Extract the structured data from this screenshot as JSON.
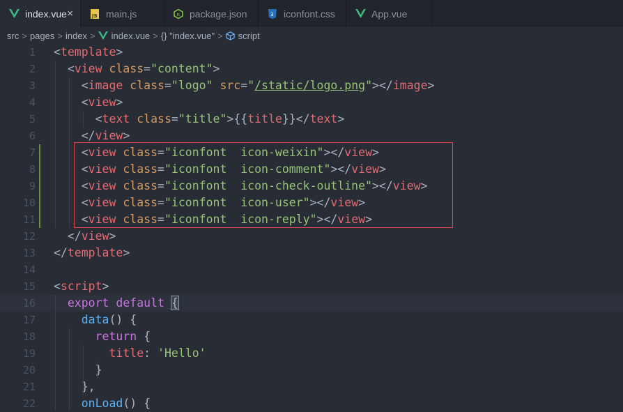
{
  "tabs": [
    {
      "label": "index.vue",
      "icon": "vue-icon",
      "active": true
    },
    {
      "label": "main.js",
      "icon": "js-icon"
    },
    {
      "label": "package.json",
      "icon": "npm-icon"
    },
    {
      "label": "iconfont.css",
      "icon": "css-icon"
    },
    {
      "label": "App.vue",
      "icon": "vue-icon"
    }
  ],
  "tab_close_glyph": "×",
  "breadcrumb": {
    "src": "src",
    "pages": "pages",
    "index": "index",
    "file": "index.vue",
    "obj": "{} \"index.vue\"",
    "script": "script",
    "sep": ">"
  },
  "colors": {
    "tag": "#e06c75",
    "attr": "#d19a66",
    "string": "#98c379",
    "keyword": "#c678dd",
    "function": "#61afef",
    "highlight_box": "#e0464a"
  },
  "code_lines": [
    [
      {
        "t": "<",
        "c": "p"
      },
      {
        "t": "template",
        "c": "t"
      },
      {
        "t": ">",
        "c": "p"
      }
    ],
    [
      {
        "t": "  <",
        "c": "p"
      },
      {
        "t": "view",
        "c": "t"
      },
      {
        "t": " ",
        "c": "p"
      },
      {
        "t": "class",
        "c": "a"
      },
      {
        "t": "=",
        "c": "p"
      },
      {
        "t": "\"content\"",
        "c": "s"
      },
      {
        "t": ">",
        "c": "p"
      }
    ],
    [
      {
        "t": "    <",
        "c": "p"
      },
      {
        "t": "image",
        "c": "t"
      },
      {
        "t": " ",
        "c": "p"
      },
      {
        "t": "class",
        "c": "a"
      },
      {
        "t": "=",
        "c": "p"
      },
      {
        "t": "\"logo\"",
        "c": "s"
      },
      {
        "t": " ",
        "c": "p"
      },
      {
        "t": "src",
        "c": "a"
      },
      {
        "t": "=",
        "c": "p"
      },
      {
        "t": "\"",
        "c": "s"
      },
      {
        "t": "/static/logo.png",
        "c": "s u"
      },
      {
        "t": "\"",
        "c": "s"
      },
      {
        "t": "></",
        "c": "p"
      },
      {
        "t": "image",
        "c": "t"
      },
      {
        "t": ">",
        "c": "p"
      }
    ],
    [
      {
        "t": "    <",
        "c": "p"
      },
      {
        "t": "view",
        "c": "t"
      },
      {
        "t": ">",
        "c": "p"
      }
    ],
    [
      {
        "t": "      <",
        "c": "p"
      },
      {
        "t": "text",
        "c": "t"
      },
      {
        "t": " ",
        "c": "p"
      },
      {
        "t": "class",
        "c": "a"
      },
      {
        "t": "=",
        "c": "p"
      },
      {
        "t": "\"title\"",
        "c": "s"
      },
      {
        "t": ">{{",
        "c": "p"
      },
      {
        "t": "title",
        "c": "t"
      },
      {
        "t": "}}</",
        "c": "p"
      },
      {
        "t": "text",
        "c": "t"
      },
      {
        "t": ">",
        "c": "p"
      }
    ],
    [
      {
        "t": "    </",
        "c": "p"
      },
      {
        "t": "view",
        "c": "t"
      },
      {
        "t": ">",
        "c": "p"
      }
    ],
    [
      {
        "t": "    <",
        "c": "p"
      },
      {
        "t": "view",
        "c": "t"
      },
      {
        "t": " ",
        "c": "p"
      },
      {
        "t": "class",
        "c": "a"
      },
      {
        "t": "=",
        "c": "p"
      },
      {
        "t": "\"iconfont  icon-weixin\"",
        "c": "s"
      },
      {
        "t": "></",
        "c": "p"
      },
      {
        "t": "view",
        "c": "t"
      },
      {
        "t": ">",
        "c": "p"
      }
    ],
    [
      {
        "t": "    <",
        "c": "p"
      },
      {
        "t": "view",
        "c": "t"
      },
      {
        "t": " ",
        "c": "p"
      },
      {
        "t": "class",
        "c": "a"
      },
      {
        "t": "=",
        "c": "p"
      },
      {
        "t": "\"iconfont  icon-comment\"",
        "c": "s"
      },
      {
        "t": "></",
        "c": "p"
      },
      {
        "t": "view",
        "c": "t"
      },
      {
        "t": ">",
        "c": "p"
      }
    ],
    [
      {
        "t": "    <",
        "c": "p"
      },
      {
        "t": "view",
        "c": "t"
      },
      {
        "t": " ",
        "c": "p"
      },
      {
        "t": "class",
        "c": "a"
      },
      {
        "t": "=",
        "c": "p"
      },
      {
        "t": "\"iconfont  icon-check-outline\"",
        "c": "s"
      },
      {
        "t": "></",
        "c": "p"
      },
      {
        "t": "view",
        "c": "t"
      },
      {
        "t": ">",
        "c": "p"
      }
    ],
    [
      {
        "t": "    <",
        "c": "p"
      },
      {
        "t": "view",
        "c": "t"
      },
      {
        "t": " ",
        "c": "p"
      },
      {
        "t": "class",
        "c": "a"
      },
      {
        "t": "=",
        "c": "p"
      },
      {
        "t": "\"iconfont  icon-user\"",
        "c": "s"
      },
      {
        "t": "></",
        "c": "p"
      },
      {
        "t": "view",
        "c": "t"
      },
      {
        "t": ">",
        "c": "p"
      }
    ],
    [
      {
        "t": "    <",
        "c": "p"
      },
      {
        "t": "view",
        "c": "t"
      },
      {
        "t": " ",
        "c": "p"
      },
      {
        "t": "class",
        "c": "a"
      },
      {
        "t": "=",
        "c": "p"
      },
      {
        "t": "\"iconfont  icon-reply\"",
        "c": "s"
      },
      {
        "t": "></",
        "c": "p"
      },
      {
        "t": "view",
        "c": "t"
      },
      {
        "t": ">",
        "c": "p"
      }
    ],
    [
      {
        "t": "  </",
        "c": "p"
      },
      {
        "t": "view",
        "c": "t"
      },
      {
        "t": ">",
        "c": "p"
      }
    ],
    [
      {
        "t": "</",
        "c": "p"
      },
      {
        "t": "template",
        "c": "t"
      },
      {
        "t": ">",
        "c": "p"
      }
    ],
    [],
    [
      {
        "t": "<",
        "c": "p"
      },
      {
        "t": "script",
        "c": "t"
      },
      {
        "t": ">",
        "c": "p"
      }
    ],
    [
      {
        "t": "  ",
        "c": "p"
      },
      {
        "t": "export",
        "c": "k"
      },
      {
        "t": " ",
        "c": "p"
      },
      {
        "t": "default",
        "c": "k"
      },
      {
        "t": " ",
        "c": "p"
      },
      {
        "t": "{",
        "c": "p brace-hl"
      }
    ],
    [
      {
        "t": "    ",
        "c": "p"
      },
      {
        "t": "data",
        "c": "f"
      },
      {
        "t": "() {",
        "c": "p"
      }
    ],
    [
      {
        "t": "      ",
        "c": "p"
      },
      {
        "t": "return",
        "c": "k"
      },
      {
        "t": " {",
        "c": "p"
      }
    ],
    [
      {
        "t": "        ",
        "c": "p"
      },
      {
        "t": "title",
        "c": "t"
      },
      {
        "t": ": ",
        "c": "p"
      },
      {
        "t": "'Hello'",
        "c": "s"
      }
    ],
    [
      {
        "t": "      }",
        "c": "p"
      }
    ],
    [
      {
        "t": "    },",
        "c": "p"
      }
    ],
    [
      {
        "t": "    ",
        "c": "p"
      },
      {
        "t": "onLoad",
        "c": "f"
      },
      {
        "t": "() {",
        "c": "p"
      }
    ]
  ],
  "line_numbers": [
    "1",
    "2",
    "3",
    "4",
    "5",
    "6",
    "7",
    "8",
    "9",
    "10",
    "11",
    "12",
    "13",
    "14",
    "15",
    "16",
    "17",
    "18",
    "19",
    "20",
    "21",
    "22"
  ]
}
